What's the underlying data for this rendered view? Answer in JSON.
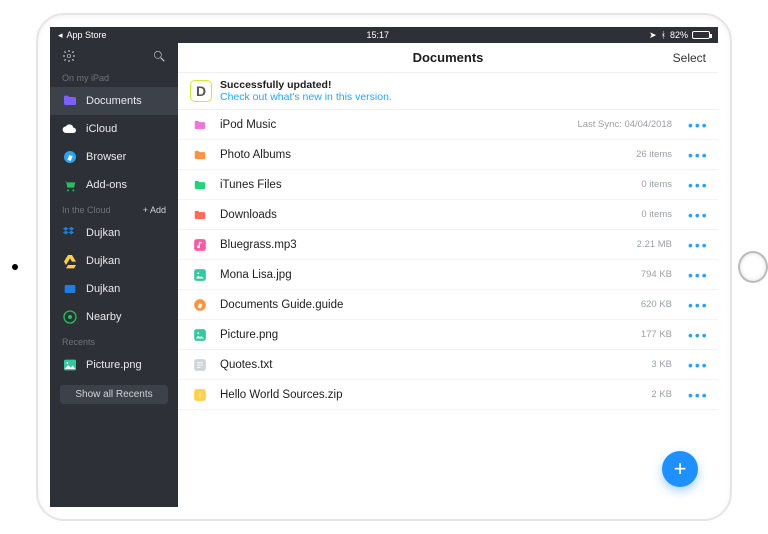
{
  "statusbar": {
    "left": "App Store",
    "time": "15:17",
    "battery": "82%"
  },
  "sidebar": {
    "sections": {
      "onmypad": {
        "title": "On my iPad",
        "items": [
          {
            "label": "Documents",
            "icon": "folder",
            "color": "#7b5fff",
            "active": true
          },
          {
            "label": "iCloud",
            "icon": "cloud",
            "color": "#ffffff",
            "active": false
          },
          {
            "label": "Browser",
            "icon": "compass",
            "color": "#2ba3ef",
            "active": false
          },
          {
            "label": "Add-ons",
            "icon": "cart",
            "color": "#25c05b",
            "active": false
          }
        ]
      },
      "incloud": {
        "title": "In the Cloud",
        "add": "+ Add",
        "items": [
          {
            "label": "Dujkan",
            "icon": "dropbox",
            "color": "#1e7fe0"
          },
          {
            "label": "Dujkan",
            "icon": "drive",
            "color": "#ffd04c"
          },
          {
            "label": "Dujkan",
            "icon": "box",
            "color": "#1e7fe0"
          },
          {
            "label": "Nearby",
            "icon": "nearby",
            "color": "#25c05b"
          }
        ]
      },
      "recents": {
        "title": "Recents",
        "items": [
          {
            "label": "Picture.png",
            "icon": "image",
            "color": "#34c7a0"
          }
        ],
        "showall": "Show all Recents"
      }
    }
  },
  "main": {
    "title": "Documents",
    "select": "Select",
    "banner": {
      "heading": "Successfully updated!",
      "sub": "Check out what's new in this version."
    },
    "rows": [
      {
        "name": "iPod Music",
        "meta": "Last Sync: 04/04/2018",
        "icon": "music-folder",
        "color": "#e879d8"
      },
      {
        "name": "Photo Albums",
        "meta": "26 items",
        "icon": "photo-folder",
        "color": "#ff9340"
      },
      {
        "name": "iTunes Files",
        "meta": "0 items",
        "icon": "folder",
        "color": "#28d17c"
      },
      {
        "name": "Downloads",
        "meta": "0 items",
        "icon": "download-folder",
        "color": "#ff6a5b"
      },
      {
        "name": "Bluegrass.mp3",
        "meta": "2.21 MB",
        "icon": "audio",
        "color": "#ff5aa0"
      },
      {
        "name": "Mona Lisa.jpg",
        "meta": "794 KB",
        "icon": "image",
        "color": "#34c7a0"
      },
      {
        "name": "Documents Guide.guide",
        "meta": "620 KB",
        "icon": "guide",
        "color": "#ff9340"
      },
      {
        "name": "Picture.png",
        "meta": "177 KB",
        "icon": "image",
        "color": "#34c7a0"
      },
      {
        "name": "Quotes.txt",
        "meta": "3 KB",
        "icon": "text",
        "color": "#cfd4da"
      },
      {
        "name": "Hello World Sources.zip",
        "meta": "2 KB",
        "icon": "zip",
        "color": "#ffd04c"
      }
    ]
  }
}
